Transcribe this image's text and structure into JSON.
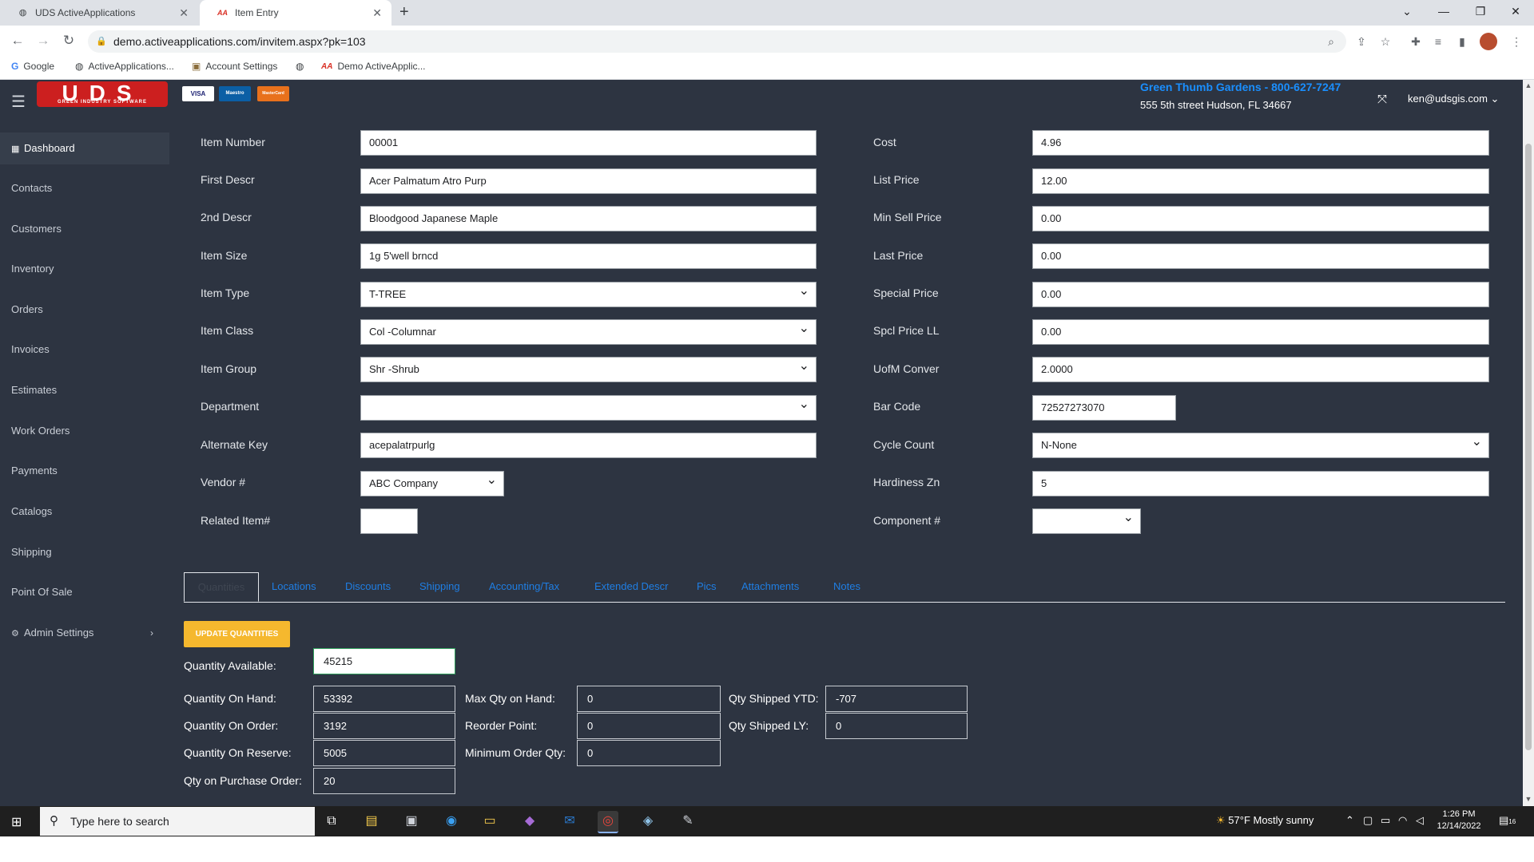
{
  "browser": {
    "tabs": [
      {
        "title": "UDS ActiveApplications",
        "icon": "globe-icon",
        "active": false
      },
      {
        "title": "Item Entry",
        "icon": "aa-logo-icon",
        "active": true
      }
    ],
    "new_tab": "+",
    "url": "demo.activeapplications.com/invitem.aspx?pk=103",
    "bookmarks": [
      {
        "label": "Google",
        "icon": "google-icon"
      },
      {
        "label": "ActiveApplications...",
        "icon": "globe-icon"
      },
      {
        "label": "Account Settings",
        "icon": "briefcase-icon"
      },
      {
        "label": "Demo ActiveApplic...",
        "icon": "aa-logo-icon"
      }
    ]
  },
  "header": {
    "logo_text": "UDS",
    "logo_subtext": "GREEN INDUSTRY SOFTWARE",
    "cards": [
      "VISA",
      "Maestro",
      "MasterCard"
    ],
    "company": "Green Thumb Gardens - 800-627-7247",
    "address": "555 5th street Hudson, FL 34667",
    "user": "ken@udsgis.com"
  },
  "sidebar": {
    "items": [
      {
        "label": "Dashboard",
        "active": true
      },
      {
        "label": "Contacts"
      },
      {
        "label": "Customers"
      },
      {
        "label": "Inventory"
      },
      {
        "label": "Orders"
      },
      {
        "label": "Invoices"
      },
      {
        "label": "Estimates"
      },
      {
        "label": "Work Orders"
      },
      {
        "label": "Payments"
      },
      {
        "label": "Catalogs"
      },
      {
        "label": "Shipping"
      },
      {
        "label": "Point Of Sale"
      },
      {
        "label": "Admin Settings"
      }
    ]
  },
  "form": {
    "left": [
      {
        "label": "Item Number",
        "value": "00001"
      },
      {
        "label": "First Descr",
        "value": "Acer Palmatum Atro Purp"
      },
      {
        "label": "2nd Descr",
        "value": "Bloodgood Japanese Maple"
      },
      {
        "label": "Item Size",
        "value": "1g 5'well brncd"
      },
      {
        "label": "Item Type",
        "value": "T-TREE"
      },
      {
        "label": "Item Class",
        "value": "Col -Columnar"
      },
      {
        "label": "Item Group",
        "value": "Shr -Shrub"
      },
      {
        "label": "Department",
        "value": ""
      },
      {
        "label": "Alternate Key",
        "value": "acepalatrpurlg"
      },
      {
        "label": "Vendor #",
        "value": "ABC Company"
      },
      {
        "label": "Related Item#",
        "value": ""
      }
    ],
    "right": [
      {
        "label": "Cost",
        "value": "4.96"
      },
      {
        "label": "List Price",
        "value": "12.00"
      },
      {
        "label": "Min Sell Price",
        "value": "0.00"
      },
      {
        "label": "Last Price",
        "value": "0.00"
      },
      {
        "label": "Special Price",
        "value": "0.00"
      },
      {
        "label": "Spcl Price LL",
        "value": "0.00"
      },
      {
        "label": "UofM Conver",
        "value": "2.0000"
      },
      {
        "label": "Bar Code",
        "value": "72527273070"
      },
      {
        "label": "Cycle Count",
        "value": "N-None"
      },
      {
        "label": "Hardiness Zn",
        "value": "5"
      },
      {
        "label": "Component #",
        "value": ""
      }
    ]
  },
  "tabs": [
    "Quantities",
    "Locations",
    "Discounts",
    "Shipping",
    "Accounting/Tax",
    "Extended Descr",
    "Pics",
    "Attachments",
    "Notes"
  ],
  "quantities": {
    "update_button": "UPDATE QUANTITIES",
    "available": {
      "label": "Quantity Available:",
      "value": "45215"
    },
    "col1": [
      {
        "label": "Quantity On Hand:",
        "value": "53392"
      },
      {
        "label": "Quantity On Order:",
        "value": "3192"
      },
      {
        "label": "Quantity On Reserve:",
        "value": "5005"
      },
      {
        "label": "Qty on Purchase Order:",
        "value": "20"
      }
    ],
    "col2": [
      {
        "label": "Max Qty on Hand:",
        "value": "0"
      },
      {
        "label": "Reorder Point:",
        "value": "0"
      },
      {
        "label": "Minimum Order Qty:",
        "value": "0"
      }
    ],
    "col3": [
      {
        "label": "Qty Shipped YTD:",
        "value": "-707"
      },
      {
        "label": "Qty Shipped LY:",
        "value": "0"
      }
    ]
  },
  "taskbar": {
    "search_placeholder": "Type here to search",
    "weather": "57°F  Mostly sunny",
    "time": "1:26 PM",
    "date": "12/14/2022",
    "notification_count": "16"
  }
}
